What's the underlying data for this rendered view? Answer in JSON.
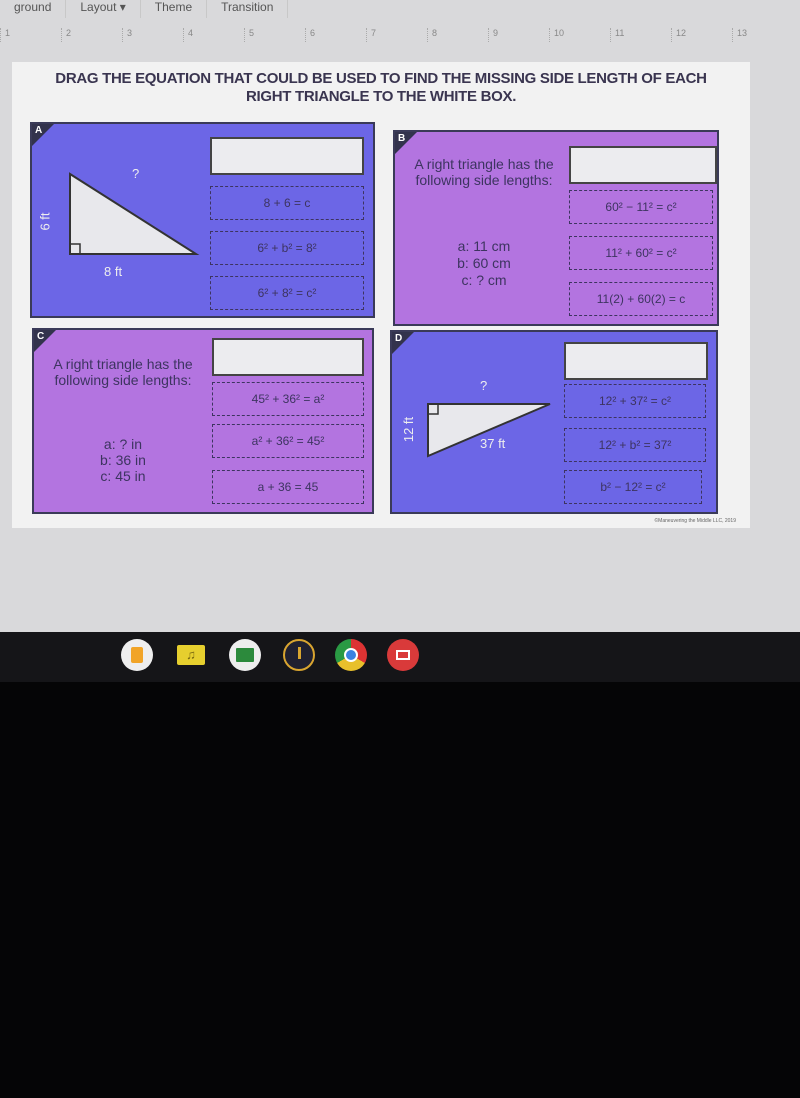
{
  "menu": [
    "ground",
    "Layout ▾",
    "Theme",
    "Transition"
  ],
  "ruler": [
    "1",
    "2",
    "3",
    "4",
    "5",
    "6",
    "7",
    "8",
    "9",
    "10",
    "11",
    "12",
    "13"
  ],
  "slide": {
    "title_line1": "DRAG THE EQUATION THAT COULD BE USED TO FIND THE MISSING SIDE LENGTH OF EACH",
    "title_line2": "RIGHT TRIANGLE TO THE WHITE BOX.",
    "credit": "©Maneuvering the Middle LLC, 2019",
    "panels": {
      "A": {
        "tag": "A",
        "side": "6 ft",
        "base": "8 ft",
        "hyp": "?",
        "options": [
          "8 + 6 = c",
          "6² + b² = 8²",
          "6² + 8² = c²"
        ]
      },
      "B": {
        "tag": "B",
        "intro": "A right triangle has the following side lengths:",
        "a": "a: 11 cm",
        "b": "b: 60 cm",
        "c": "c: ? cm",
        "options": [
          "60² − 11² = c²",
          "11² + 60² = c²",
          "11(2) + 60(2) = c"
        ]
      },
      "C": {
        "tag": "C",
        "intro": "A right triangle has the following side lengths:",
        "a": "a: ? in",
        "b": "b: 36 in",
        "c": "c: 45 in",
        "options": [
          "45² + 36² = a²",
          "a² + 36² = 45²",
          "a + 36 = 45"
        ]
      },
      "D": {
        "tag": "D",
        "side": "12 ft",
        "hyp": "37 ft",
        "base": "?",
        "options": [
          "12² + 37² = c²",
          "12² + b² = 37²",
          "b² − 12² = c²"
        ]
      }
    }
  },
  "colors": {
    "blue_panel": "#6c66e6",
    "purple_panel": "#b374e0"
  },
  "shelf": [
    "slides-icon",
    "music-folder-icon",
    "classroom-icon",
    "power-icon",
    "chrome-icon",
    "video-icon"
  ]
}
